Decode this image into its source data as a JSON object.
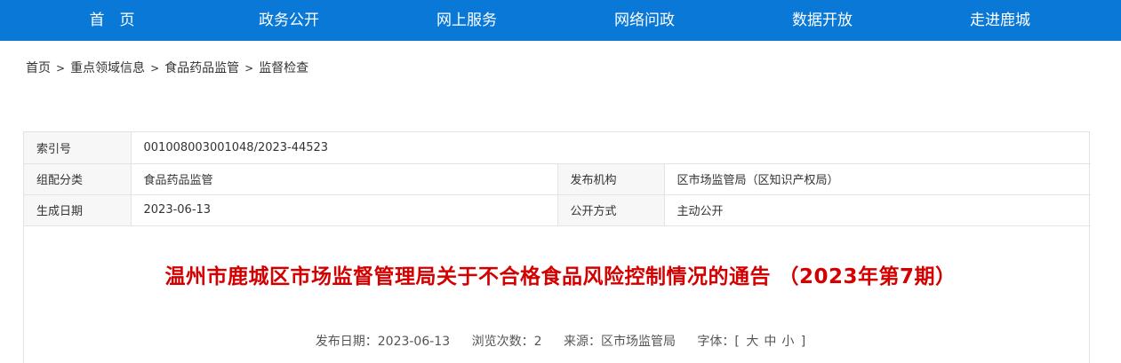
{
  "nav": {
    "items": [
      "首　页",
      "政务公开",
      "网上服务",
      "网络问政",
      "数据开放",
      "走进鹿城"
    ],
    "color": "#0a78d6"
  },
  "breadcrumb": {
    "items": [
      "首页",
      "重点领域信息",
      "食品药品监管",
      "监督检查"
    ],
    "separator": ">"
  },
  "meta": {
    "index_label": "索引号",
    "index_value": "001008003001048/2023-44523",
    "category_label": "组配分类",
    "category_value": "食品药品监管",
    "publisher_label": "发布机构",
    "publisher_value": "区市场监管局（区知识产权局）",
    "date_label": "生成日期",
    "date_value": "2023-06-13",
    "mode_label": "公开方式",
    "mode_value": "主动公开"
  },
  "article": {
    "title": "温州市鹿城区市场监督管理局关于不合格食品风险控制情况的通告 （2023年第7期）",
    "title_color": "#d40000",
    "publish_date_label": "发布日期：",
    "publish_date": "2023-06-13",
    "views_label": "浏览次数：",
    "views": "2",
    "source_label": "来源：",
    "source": "区市场监管局",
    "fontsize_label": "字体：",
    "bracket_open": "[",
    "size_large": "大",
    "size_medium": "中",
    "size_small": "小",
    "bracket_close": "]"
  }
}
